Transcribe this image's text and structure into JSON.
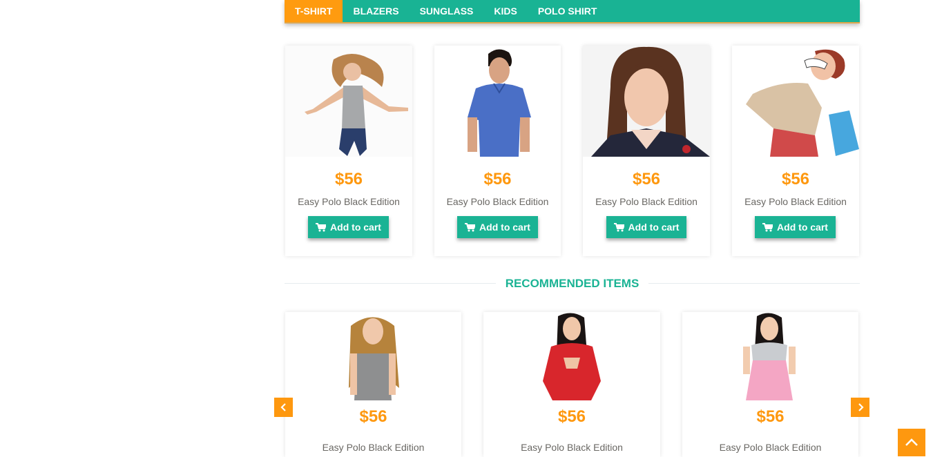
{
  "tabs": [
    {
      "label": "T-SHIRT",
      "active": true
    },
    {
      "label": "BLAZERS",
      "active": false
    },
    {
      "label": "SUNGLASS",
      "active": false
    },
    {
      "label": "KIDS",
      "active": false
    },
    {
      "label": "POLO SHIRT",
      "active": false
    }
  ],
  "products": [
    {
      "price": "$56",
      "name": "Easy Polo Black Edition",
      "button": "Add to cart",
      "image": "woman-dancing-grey-top"
    },
    {
      "price": "$56",
      "name": "Easy Polo Black Edition",
      "button": "Add to cart",
      "image": "man-blue-polo"
    },
    {
      "price": "$56",
      "name": "Easy Polo Black Edition",
      "button": "Add to cart",
      "image": "woman-portrait-brown-hair"
    },
    {
      "price": "$56",
      "name": "Easy Polo Black Edition",
      "button": "Add to cart",
      "image": "woman-sunglasses-shopping-bag"
    }
  ],
  "recommended": {
    "title": "RECOMMENDED ITEMS",
    "items": [
      {
        "price": "$56",
        "name": "Easy Polo Black Edition",
        "image": "girl-grey-top-long-hair"
      },
      {
        "price": "$56",
        "name": "Easy Polo Black Edition",
        "image": "woman-red-qipao"
      },
      {
        "price": "$56",
        "name": "Easy Polo Black Edition",
        "image": "woman-pink-dress"
      }
    ],
    "prev_icon": "chevron-left-icon",
    "next_icon": "chevron-right-icon"
  },
  "scroll_top_icon": "chevron-up-icon",
  "colors": {
    "accent_green": "#19b394",
    "accent_orange": "#fe980f",
    "text_grey": "#696763"
  }
}
